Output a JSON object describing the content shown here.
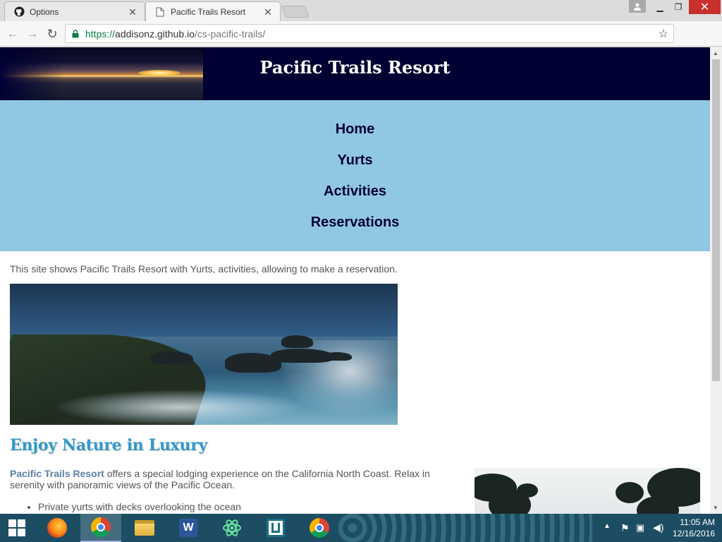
{
  "browser": {
    "tabs": [
      {
        "title": "Options",
        "icon": "github-icon"
      },
      {
        "title": "Pacific Trails Resort",
        "icon": "page-icon"
      }
    ],
    "url": {
      "scheme": "https://",
      "host": "addisonz.github.io",
      "path": "/cs-pacific-trails/"
    }
  },
  "page": {
    "site_title": "Pacific Trails Resort",
    "nav": [
      "Home",
      "Yurts",
      "Activities",
      "Reservations"
    ],
    "intro": "This site shows Pacific Trails Resort with Yurts, activities, allowing to make a reservation.",
    "section_heading": "Enjoy Nature in Luxury",
    "paragraph_strong": "Pacific Trails Resort",
    "paragraph_rest": " offers a special lodging experience on the California North Coast. Relax in serenity with panoramic views of the Pacific Ocean.",
    "features": [
      "Private yurts with decks overlooking the ocean"
    ]
  },
  "taskbar": {
    "apps": [
      "firefox-icon",
      "chrome-icon",
      "file-explorer-icon",
      "word-icon",
      "atom-icon",
      "app-icon",
      "chrome-icon"
    ],
    "time": "11:05 AM",
    "date": "12/16/2016"
  },
  "colors": {
    "header_bg": "#000033",
    "nav_bg": "#90c7e3",
    "heading": "#3399cc",
    "close_button": "#c7302b"
  }
}
